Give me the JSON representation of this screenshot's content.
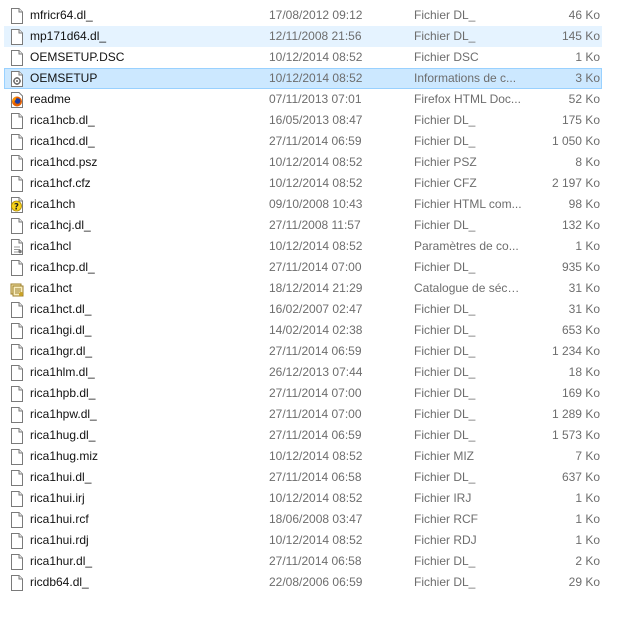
{
  "colors": {
    "hover_background": "#e5f3ff",
    "selected_background": "#cce8ff",
    "selected_border": "#99d1ff",
    "secondary_text": "#6d6d6d"
  },
  "files": [
    {
      "name": "mfricr64.dl_",
      "date": "17/08/2012 09:12",
      "type": "Fichier DL_",
      "size": "46 Ko",
      "icon": "file-icon",
      "state": ""
    },
    {
      "name": "mp171d64.dl_",
      "date": "12/11/2008 21:56",
      "type": "Fichier DL_",
      "size": "145 Ko",
      "icon": "file-icon",
      "state": "hover"
    },
    {
      "name": "OEMSETUP.DSC",
      "date": "10/12/2014 08:52",
      "type": "Fichier DSC",
      "size": "1 Ko",
      "icon": "file-icon",
      "state": ""
    },
    {
      "name": "OEMSETUP",
      "date": "10/12/2014 08:52",
      "type": "Informations de c...",
      "size": "3 Ko",
      "icon": "setup-info-icon",
      "state": "selected"
    },
    {
      "name": "readme",
      "date": "07/11/2013 07:01",
      "type": "Firefox HTML Doc...",
      "size": "52 Ko",
      "icon": "firefox-html-icon",
      "state": ""
    },
    {
      "name": "rica1hcb.dl_",
      "date": "16/05/2013 08:47",
      "type": "Fichier DL_",
      "size": "175 Ko",
      "icon": "file-icon",
      "state": ""
    },
    {
      "name": "rica1hcd.dl_",
      "date": "27/11/2014 06:59",
      "type": "Fichier DL_",
      "size": "1 050 Ko",
      "icon": "file-icon",
      "state": ""
    },
    {
      "name": "rica1hcd.psz",
      "date": "10/12/2014 08:52",
      "type": "Fichier PSZ",
      "size": "8 Ko",
      "icon": "file-icon",
      "state": ""
    },
    {
      "name": "rica1hcf.cfz",
      "date": "10/12/2014 08:52",
      "type": "Fichier CFZ",
      "size": "2 197 Ko",
      "icon": "file-icon",
      "state": ""
    },
    {
      "name": "rica1hch",
      "date": "09/10/2008 10:43",
      "type": "Fichier HTML com...",
      "size": "98 Ko",
      "icon": "help-file-icon",
      "state": ""
    },
    {
      "name": "rica1hcj.dl_",
      "date": "27/11/2008 11:57",
      "type": "Fichier DL_",
      "size": "132 Ko",
      "icon": "file-icon",
      "state": ""
    },
    {
      "name": "rica1hcl",
      "date": "10/12/2014 08:52",
      "type": "Paramètres de co...",
      "size": "1 Ko",
      "icon": "settings-file-icon",
      "state": ""
    },
    {
      "name": "rica1hcp.dl_",
      "date": "27/11/2014 07:00",
      "type": "Fichier DL_",
      "size": "935 Ko",
      "icon": "file-icon",
      "state": ""
    },
    {
      "name": "rica1hct",
      "date": "18/12/2014 21:29",
      "type": "Catalogue de sécu...",
      "size": "31 Ko",
      "icon": "security-catalog-icon",
      "state": ""
    },
    {
      "name": "rica1hct.dl_",
      "date": "16/02/2007 02:47",
      "type": "Fichier DL_",
      "size": "31 Ko",
      "icon": "file-icon",
      "state": ""
    },
    {
      "name": "rica1hgi.dl_",
      "date": "14/02/2014 02:38",
      "type": "Fichier DL_",
      "size": "653 Ko",
      "icon": "file-icon",
      "state": ""
    },
    {
      "name": "rica1hgr.dl_",
      "date": "27/11/2014 06:59",
      "type": "Fichier DL_",
      "size": "1 234 Ko",
      "icon": "file-icon",
      "state": ""
    },
    {
      "name": "rica1hlm.dl_",
      "date": "26/12/2013 07:44",
      "type": "Fichier DL_",
      "size": "18 Ko",
      "icon": "file-icon",
      "state": ""
    },
    {
      "name": "rica1hpb.dl_",
      "date": "27/11/2014 07:00",
      "type": "Fichier DL_",
      "size": "169 Ko",
      "icon": "file-icon",
      "state": ""
    },
    {
      "name": "rica1hpw.dl_",
      "date": "27/11/2014 07:00",
      "type": "Fichier DL_",
      "size": "1 289 Ko",
      "icon": "file-icon",
      "state": ""
    },
    {
      "name": "rica1hug.dl_",
      "date": "27/11/2014 06:59",
      "type": "Fichier DL_",
      "size": "1 573 Ko",
      "icon": "file-icon",
      "state": ""
    },
    {
      "name": "rica1hug.miz",
      "date": "10/12/2014 08:52",
      "type": "Fichier MIZ",
      "size": "7 Ko",
      "icon": "file-icon",
      "state": ""
    },
    {
      "name": "rica1hui.dl_",
      "date": "27/11/2014 06:58",
      "type": "Fichier DL_",
      "size": "637 Ko",
      "icon": "file-icon",
      "state": ""
    },
    {
      "name": "rica1hui.irj",
      "date": "10/12/2014 08:52",
      "type": "Fichier IRJ",
      "size": "1 Ko",
      "icon": "file-icon",
      "state": ""
    },
    {
      "name": "rica1hui.rcf",
      "date": "18/06/2008 03:47",
      "type": "Fichier RCF",
      "size": "1 Ko",
      "icon": "file-icon",
      "state": ""
    },
    {
      "name": "rica1hui.rdj",
      "date": "10/12/2014 08:52",
      "type": "Fichier RDJ",
      "size": "1 Ko",
      "icon": "file-icon",
      "state": ""
    },
    {
      "name": "rica1hur.dl_",
      "date": "27/11/2014 06:58",
      "type": "Fichier DL_",
      "size": "2 Ko",
      "icon": "file-icon",
      "state": ""
    },
    {
      "name": "ricdb64.dl_",
      "date": "22/08/2006 06:59",
      "type": "Fichier DL_",
      "size": "29 Ko",
      "icon": "file-icon",
      "state": ""
    }
  ]
}
